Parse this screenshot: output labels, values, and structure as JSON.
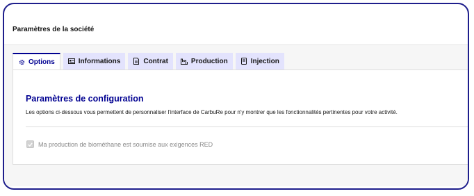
{
  "header": {
    "title": "Paramètres de la société"
  },
  "tabs": [
    {
      "label": "Options",
      "icon": "gear-icon",
      "active": true
    },
    {
      "label": "Informations",
      "icon": "id-card-icon",
      "active": false
    },
    {
      "label": "Contrat",
      "icon": "document-icon",
      "active": false
    },
    {
      "label": "Production",
      "icon": "factory-icon",
      "active": false
    },
    {
      "label": "Injection",
      "icon": "plug-icon",
      "active": false
    }
  ],
  "panel": {
    "title": "Paramètres de configuration",
    "description": "Les options ci-dessous vous permettent de personnaliser l'interface de CarbuRe pour n'y montrer que les fonctionnalités pertinentes pour votre activité.",
    "checkbox": {
      "label": "Ma production de biométhane est soumise aux exigences RED",
      "checked": true,
      "disabled": true
    }
  },
  "colors": {
    "accent": "#000091",
    "tab_background": "#e3e3fd",
    "frame_border": "#1e1e8c"
  }
}
